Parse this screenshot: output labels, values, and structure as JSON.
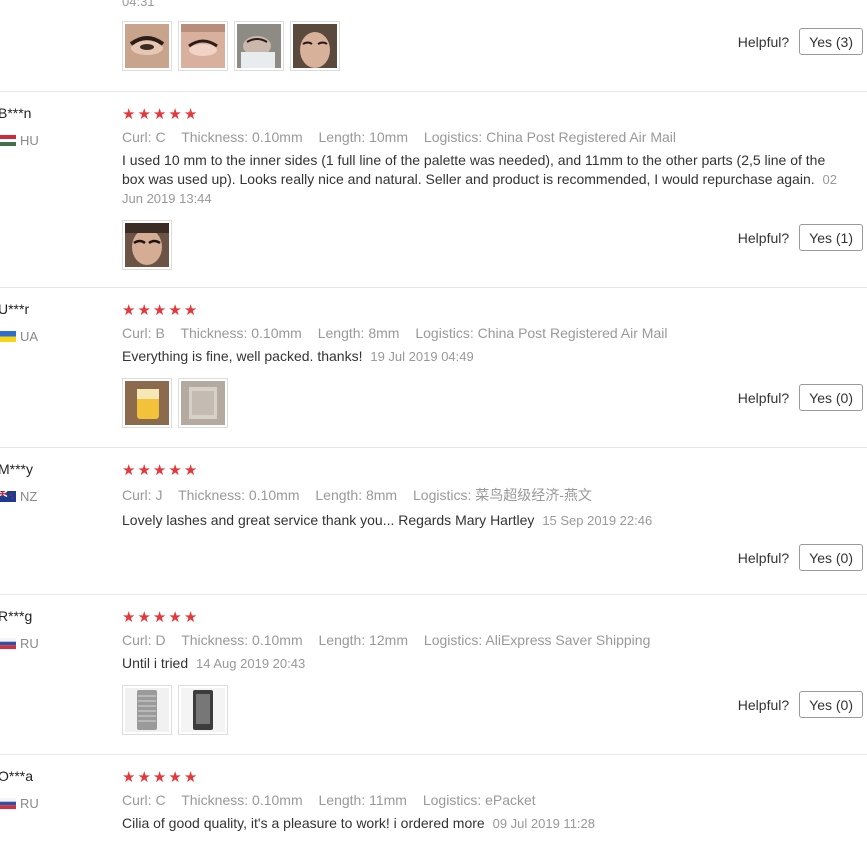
{
  "labels": {
    "curl": "Curl:",
    "thickness": "Thickness:",
    "length": "Length:",
    "logistics": "Logistics:",
    "helpful": "Helpful?"
  },
  "top_partial": {
    "timestamp": "04:31",
    "helpful_btn": "Yes (3)",
    "photos": [
      "eye-photo",
      "eye-photo",
      "face-photo",
      "face-photo"
    ]
  },
  "reviews": [
    {
      "user": "B***n",
      "country": "HU",
      "stars": 5,
      "curl": "C",
      "thickness": "0.10mm",
      "length": "10mm",
      "logistics": "China Post Registered Air Mail",
      "text": "I used 10 mm to the inner sides (1 full line of the palette was needed), and 11mm to the other parts (2,5 line of the box was used up). Looks really nice and natural. Seller and product is recommended, I would repurchase again.",
      "timestamp": "02 Jun 2019 13:44",
      "helpful_btn": "Yes (1)",
      "photos": [
        "face-photo"
      ]
    },
    {
      "user": "U***r",
      "country": "UA",
      "stars": 5,
      "curl": "B",
      "thickness": "0.10mm",
      "length": "8mm",
      "logistics": "China Post Registered Air Mail",
      "text": "Everything is fine, well packed. thanks!",
      "timestamp": "19 Jul 2019 04:49",
      "helpful_btn": "Yes (0)",
      "photos": [
        "package-photo",
        "package-photo"
      ]
    },
    {
      "user": "M***y",
      "country": "NZ",
      "stars": 5,
      "curl": "J",
      "thickness": "0.10mm",
      "length": "8mm",
      "logistics": "菜鸟超级经济-燕文",
      "text": "Lovely lashes and great service thank you... Regards Mary Hartley",
      "timestamp": "15 Sep 2019 22:46",
      "helpful_btn": "Yes (0)",
      "photos": []
    },
    {
      "user": "R***g",
      "country": "RU",
      "stars": 5,
      "curl": "D",
      "thickness": "0.10mm",
      "length": "12mm",
      "logistics": "AliExpress Saver Shipping",
      "text": "Until i tried",
      "timestamp": "14 Aug 2019 20:43",
      "helpful_btn": "Yes (0)",
      "photos": [
        "lash-tray-photo",
        "lash-tray-photo"
      ]
    },
    {
      "user": "O***a",
      "country": "RU",
      "stars": 5,
      "curl": "C",
      "thickness": "0.10mm",
      "length": "11mm",
      "logistics": "ePacket",
      "text": "Cilia of good quality, it's a pleasure to work! i ordered more",
      "timestamp": "09 Jul 2019 11:28",
      "helpful_btn": "",
      "photos": []
    }
  ],
  "colors": {
    "star": "#e4393c",
    "muted": "#999999",
    "divider": "#e8e8e8"
  }
}
